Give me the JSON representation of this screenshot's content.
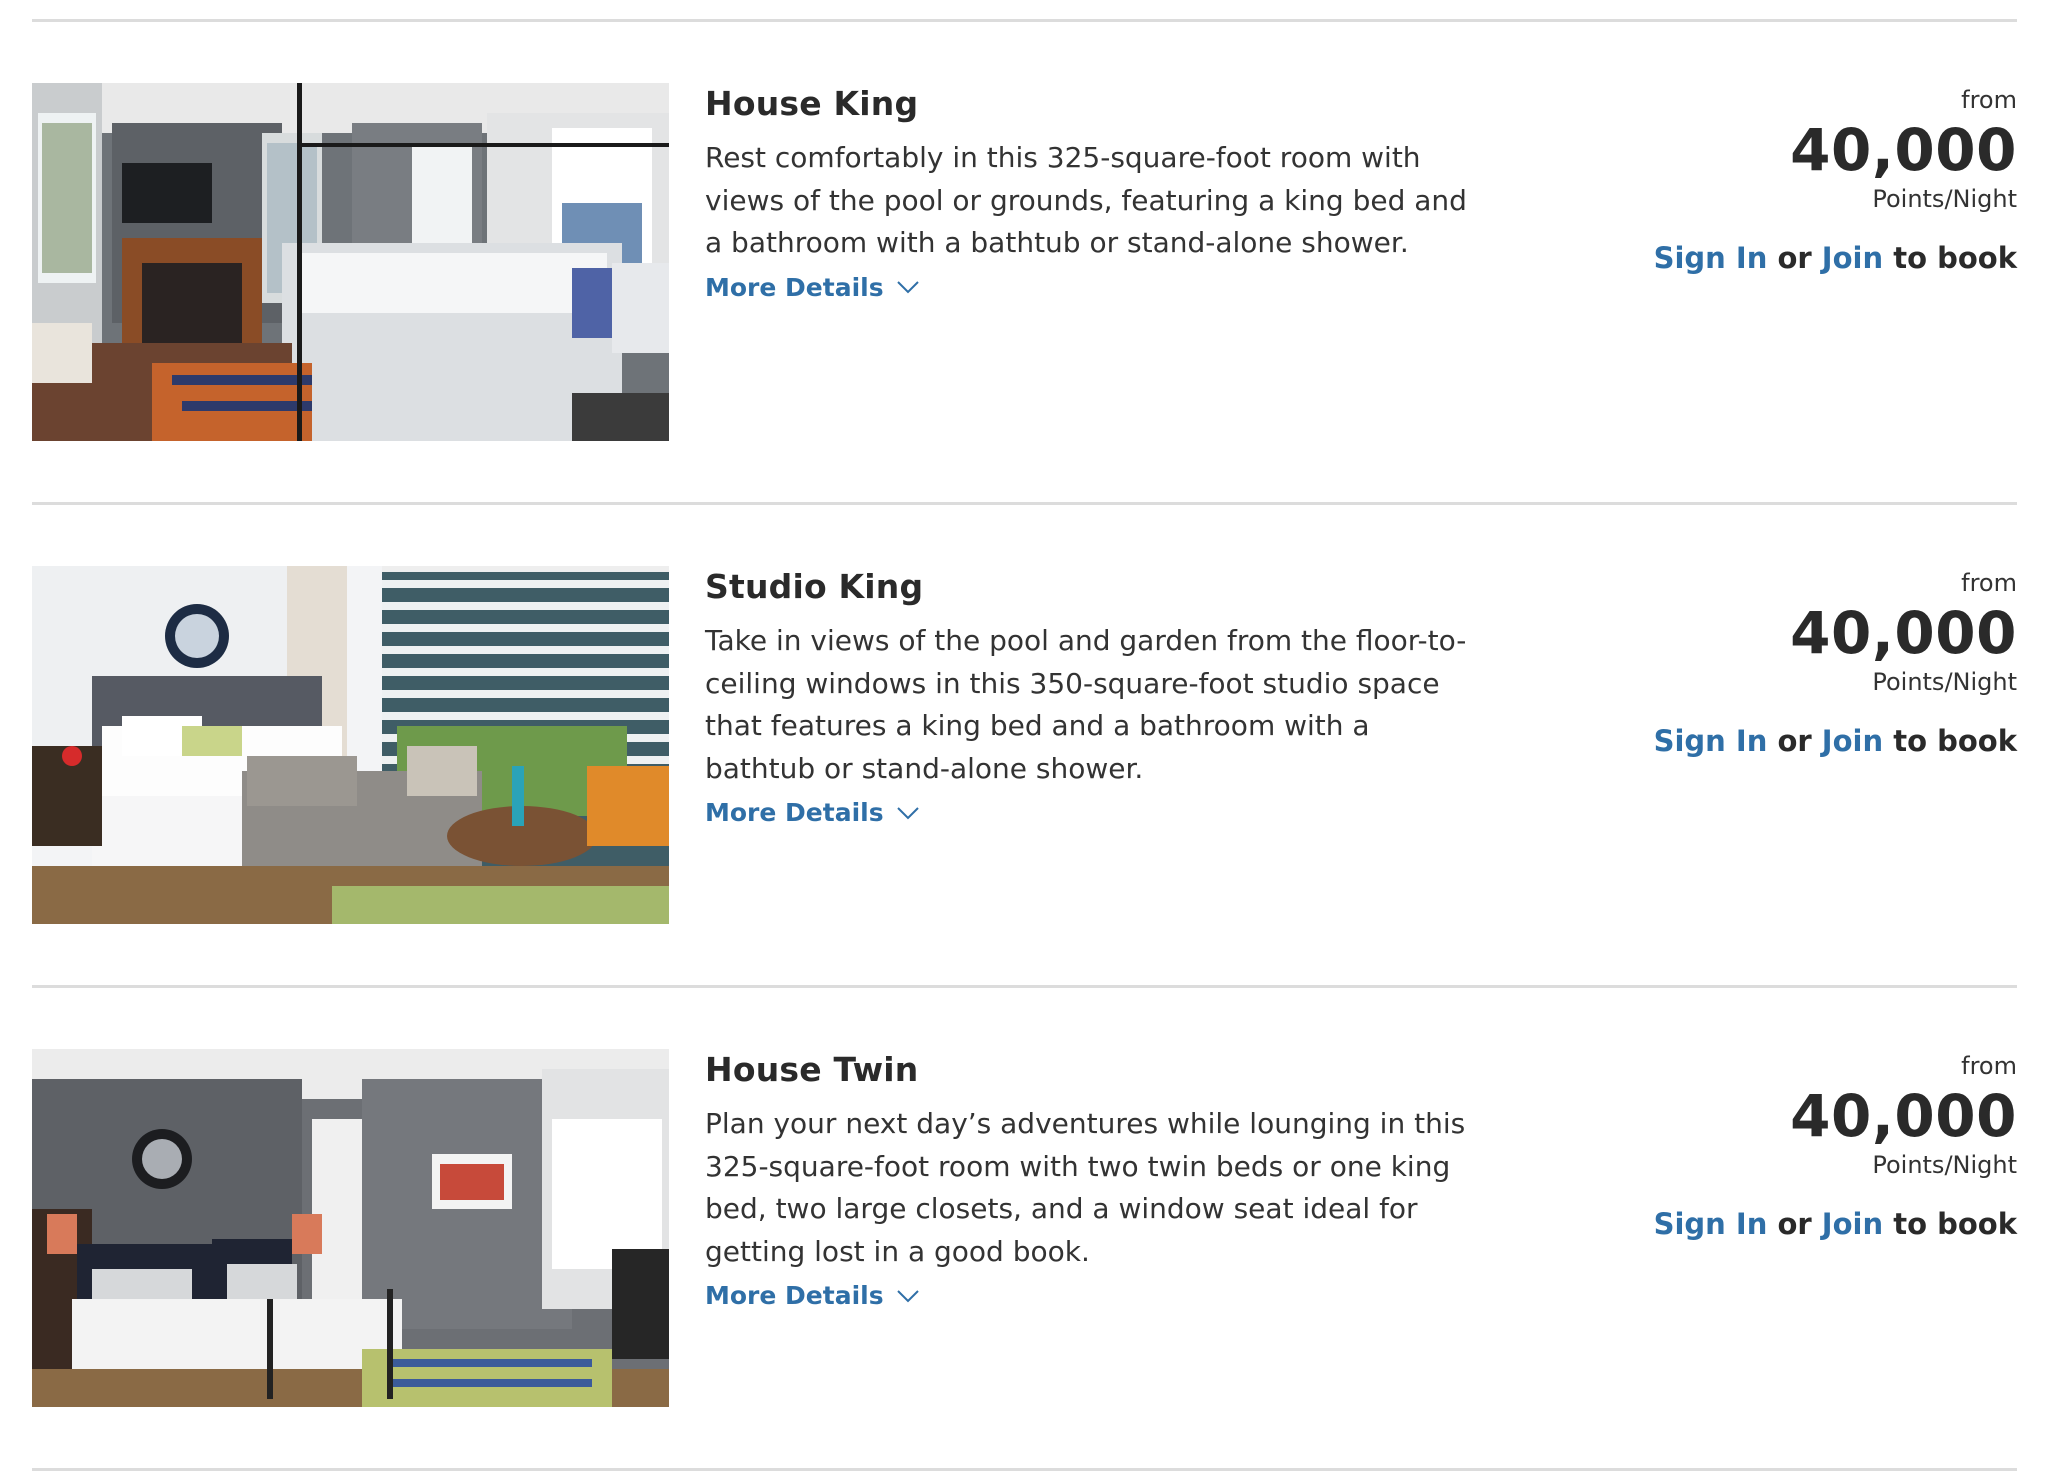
{
  "rooms": [
    {
      "name": "House King",
      "description": "Rest comfortably in this 325-square-foot room with views of the pool or grounds, featuring a king bed and a bathroom with a bathtub or stand-alone shower.",
      "more_details": "More Details",
      "from_label": "from",
      "points": "40,000",
      "unit": "Points/Night",
      "sign_in": "Sign In",
      "or": "or",
      "join": "Join",
      "to_book": "to book"
    },
    {
      "name": "Studio King",
      "description": "Take in views of the pool and garden from the floor-to-ceiling windows in this 350-square-foot studio space that features a king bed and a bathroom with a bathtub or stand-alone shower.",
      "more_details": "More Details",
      "from_label": "from",
      "points": "40,000",
      "unit": "Points/Night",
      "sign_in": "Sign In",
      "or": "or",
      "join": "Join",
      "to_book": "to book"
    },
    {
      "name": "House Twin",
      "description": "Plan your next day’s adventures while lounging in this 325-square-foot room with two twin beds or one king bed, two large closets, and a window seat ideal for getting lost in a good book.",
      "more_details": "More Details",
      "from_label": "from",
      "points": "40,000",
      "unit": "Points/Night",
      "sign_in": "Sign In",
      "or": "or",
      "join": "Join",
      "to_book": "to book"
    }
  ],
  "colors": {
    "link": "#2f6fa7",
    "divider": "#dcdcdc",
    "text": "#2a2a2a"
  }
}
